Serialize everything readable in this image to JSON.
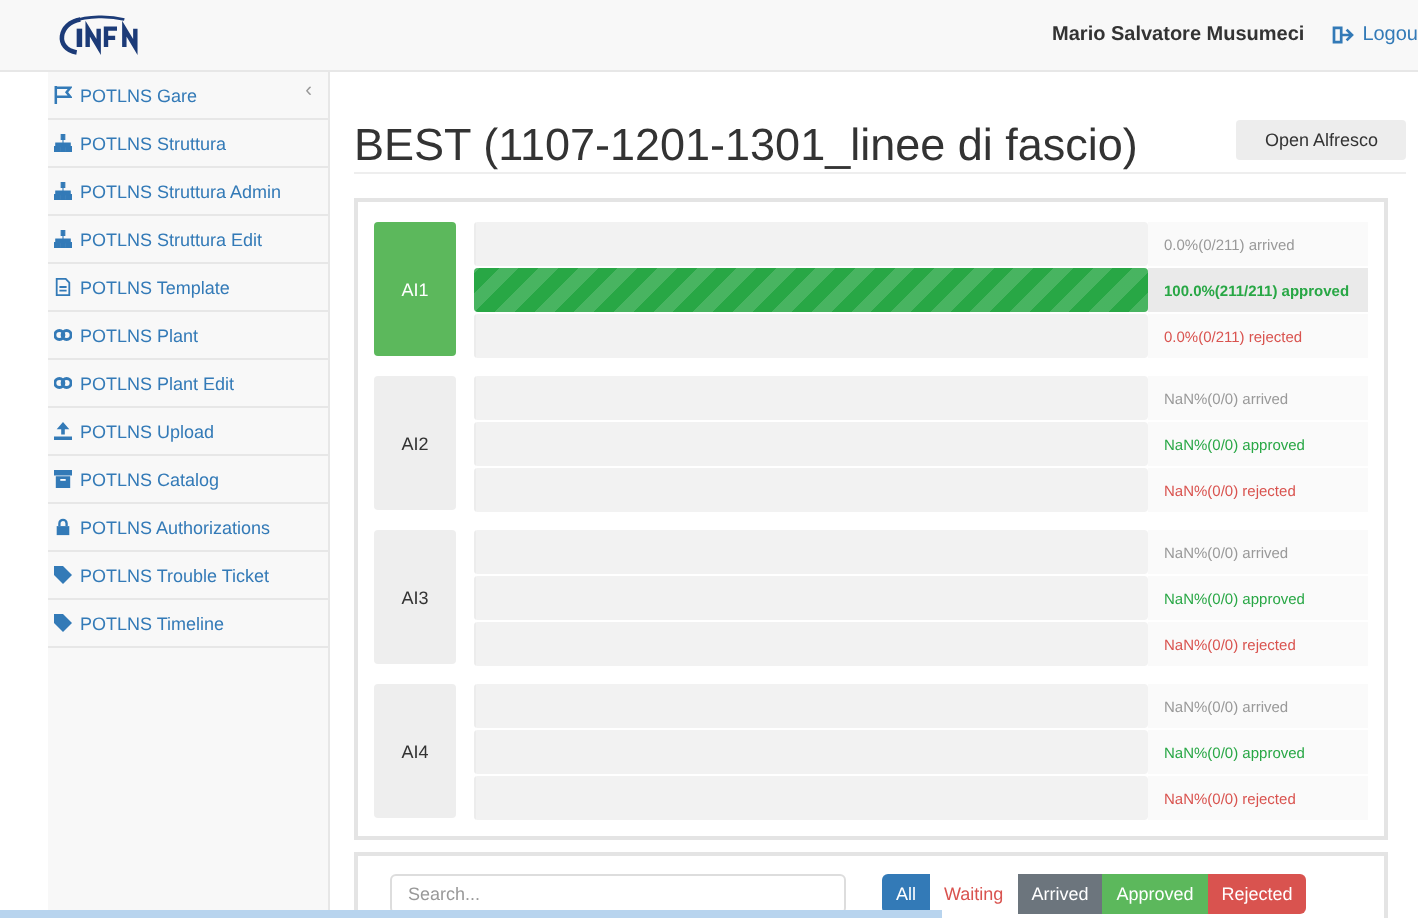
{
  "header": {
    "user": "Mario Salvatore Musumeci",
    "logout": "Logou"
  },
  "sidebar": {
    "items": [
      {
        "label": "POTLNS Gare",
        "caret": "‹"
      },
      {
        "label": "POTLNS Struttura"
      },
      {
        "label": "POTLNS Struttura Admin"
      },
      {
        "label": "POTLNS Struttura Edit"
      },
      {
        "label": "POTLNS Template"
      },
      {
        "label": "POTLNS Plant"
      },
      {
        "label": "POTLNS Plant Edit"
      },
      {
        "label": "POTLNS Upload"
      },
      {
        "label": "POTLNS Catalog"
      },
      {
        "label": "POTLNS Authorizations"
      },
      {
        "label": "POTLNS Trouble Ticket"
      },
      {
        "label": "POTLNS Timeline"
      }
    ]
  },
  "title": "BEST (1107-1201-1301_linee di fascio)",
  "open_button": "Open Alfresco",
  "groups": [
    {
      "name": "AI1",
      "complete": true,
      "rows": [
        {
          "kind": "arrived",
          "level": 0,
          "reading": "0.0%(0/211) arrived"
        },
        {
          "kind": "approved",
          "level": 1,
          "reading": "100.0%(211/211) approved"
        },
        {
          "kind": "rejected",
          "level": 0,
          "reading": "0.0%(0/211) rejected"
        }
      ]
    },
    {
      "name": "AI2",
      "complete": false,
      "rows": [
        {
          "kind": "arrived",
          "level": 0,
          "reading": "NaN%(0/0) arrived"
        },
        {
          "kind": "approved",
          "level": 0,
          "reading": "NaN%(0/0) approved"
        },
        {
          "kind": "rejected",
          "level": 0,
          "reading": "NaN%(0/0) rejected"
        }
      ]
    },
    {
      "name": "AI3",
      "complete": false,
      "rows": [
        {
          "kind": "arrived",
          "level": 0,
          "reading": "NaN%(0/0) arrived"
        },
        {
          "kind": "approved",
          "level": 0,
          "reading": "NaN%(0/0) approved"
        },
        {
          "kind": "rejected",
          "level": 0,
          "reading": "NaN%(0/0) rejected"
        }
      ]
    },
    {
      "name": "AI4",
      "complete": false,
      "rows": [
        {
          "kind": "arrived",
          "level": 0,
          "reading": "NaN%(0/0) arrived"
        },
        {
          "kind": "approved",
          "level": 0,
          "reading": "NaN%(0/0) approved"
        },
        {
          "kind": "rejected",
          "level": 0,
          "reading": "NaN%(0/0) rejected"
        }
      ]
    }
  ],
  "search": {
    "placeholder": "Search..."
  },
  "filters": [
    {
      "label": "All",
      "kind": "all",
      "selected": true
    },
    {
      "label": "Waiting",
      "kind": "waiting",
      "selected": false
    },
    {
      "label": "Arrived",
      "kind": "arrived",
      "selected": false
    },
    {
      "label": "Approved",
      "kind": "approved",
      "selected": false
    },
    {
      "label": "Rejected",
      "kind": "rejected",
      "selected": false
    }
  ]
}
